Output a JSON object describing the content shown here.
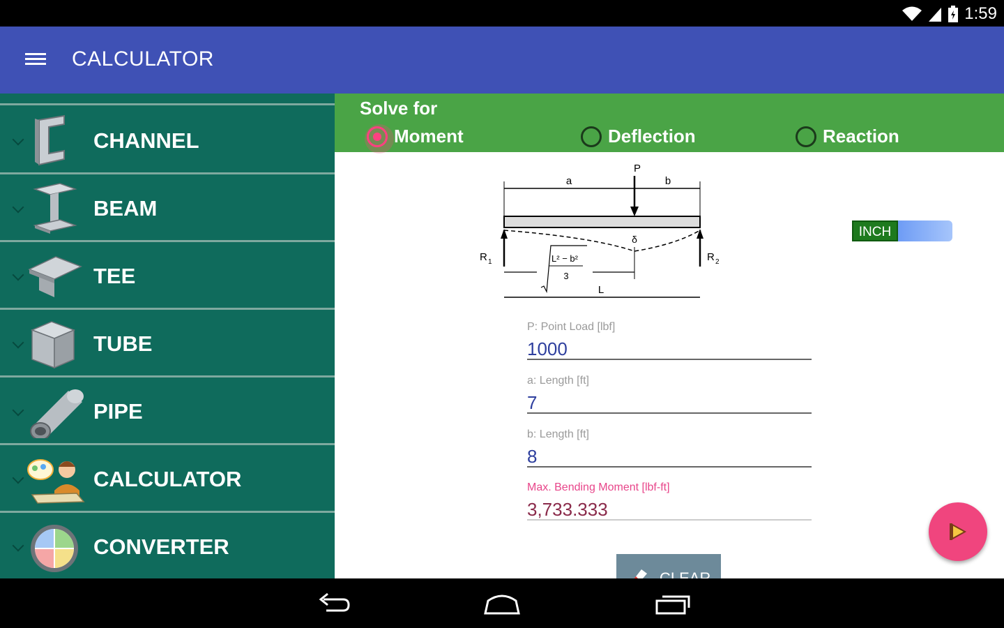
{
  "status_bar": {
    "time": "1:59",
    "icons": [
      "wifi-icon",
      "signal-icon",
      "battery-icon"
    ]
  },
  "app_bar": {
    "title": "CALCULATOR",
    "menu_icon": "hamburger-menu-icon"
  },
  "sidebar": {
    "items": [
      {
        "label": "CHANNEL",
        "icon": "channel-icon"
      },
      {
        "label": "BEAM",
        "icon": "beam-icon"
      },
      {
        "label": "TEE",
        "icon": "tee-icon"
      },
      {
        "label": "TUBE",
        "icon": "tube-icon"
      },
      {
        "label": "PIPE",
        "icon": "pipe-icon"
      },
      {
        "label": "CALCULATOR",
        "icon": "calculator-person-icon"
      },
      {
        "label": "CONVERTER",
        "icon": "converter-globe-icon"
      }
    ]
  },
  "solve_for": {
    "title": "Solve for",
    "options": [
      {
        "label": "Moment",
        "selected": true
      },
      {
        "label": "Deflection",
        "selected": false
      },
      {
        "label": "Reaction",
        "selected": false
      }
    ]
  },
  "diagram": {
    "labels": {
      "p": "P",
      "a": "a",
      "b": "b",
      "delta": "δ",
      "r1": "R",
      "r1_sub": "1",
      "r2": "R",
      "r2_sub": "2",
      "l": "L",
      "formula_num": "L² − b²",
      "formula_den": "3"
    }
  },
  "unit_toggle": {
    "label": "INCH"
  },
  "fields": [
    {
      "label": "P: Point Load [lbf]",
      "value": "1000"
    },
    {
      "label": "a: Length [ft]",
      "value": "7"
    },
    {
      "label": "b: Length [ft]",
      "value": "8"
    }
  ],
  "result": {
    "label": "Max. Bending Moment [lbf-ft]",
    "value": "3,733.333"
  },
  "clear_button": {
    "label": "CLEAR"
  },
  "colors": {
    "app_bar": "#3f51b5",
    "sidebar": "#0f6b5c",
    "solve_panel": "#4aa446",
    "accent": "#ff4081",
    "fab": "#f0457e"
  },
  "nav_bar": {
    "icons": [
      "back-icon",
      "home-icon",
      "recents-icon"
    ]
  }
}
